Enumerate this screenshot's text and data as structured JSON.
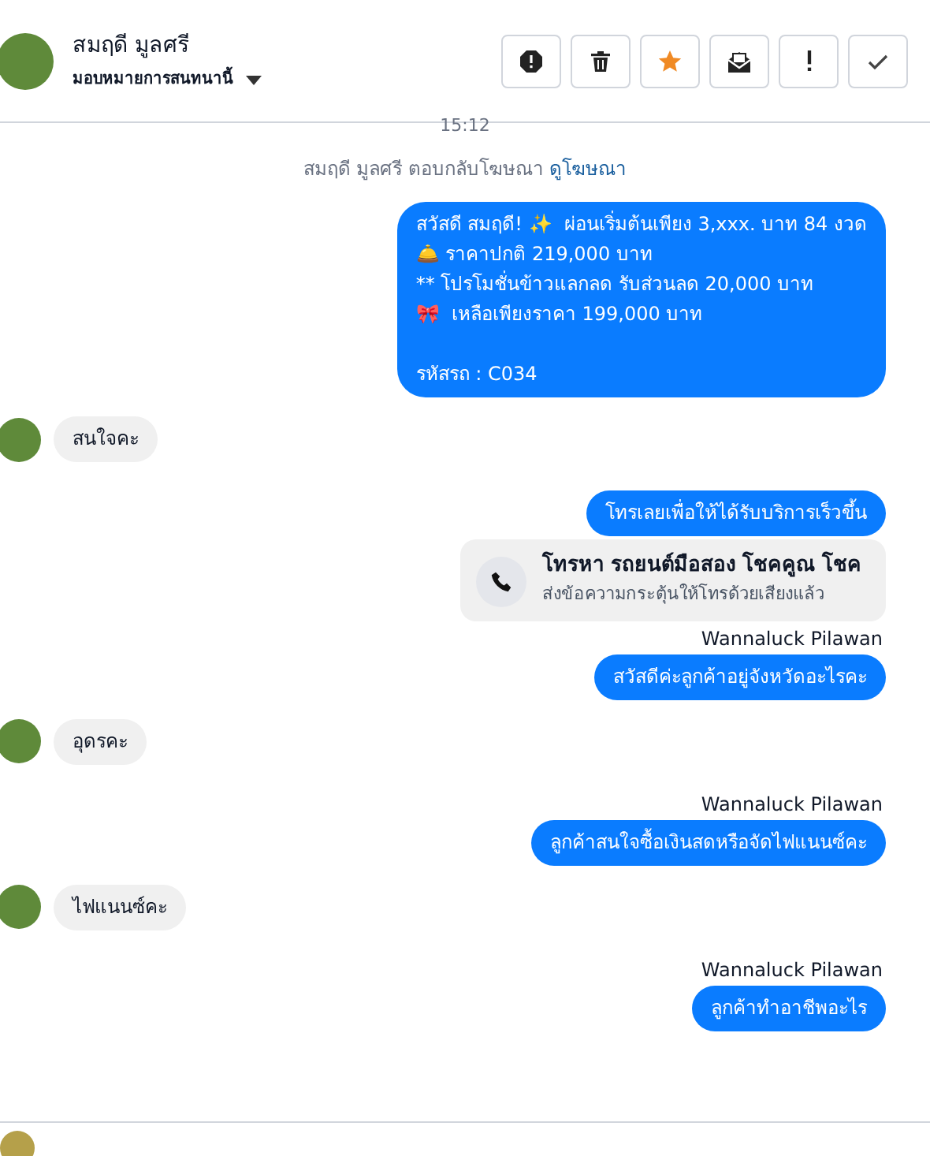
{
  "header": {
    "name": "สมฤดี มูลศรี",
    "assign": "มอบหมายการสนทนานี้",
    "actions": [
      {
        "kind": "spam"
      },
      {
        "kind": "trash"
      },
      {
        "kind": "star"
      },
      {
        "kind": "mail"
      },
      {
        "kind": "exclaim"
      },
      {
        "kind": "check"
      }
    ]
  },
  "time": "15:12",
  "notice": {
    "text": "สมฤดี มูลศรี ตอบกลับโฆษณา",
    "link": "ดูโฆษณา"
  },
  "messages": [
    {
      "kind": "out",
      "lines": [
        "สวัสดี สมฤดี! ✨  ผ่อนเริ่มต้นเพียง 3,xxx. บาท 84 งวด",
        "🛎️ ราคาปกติ 219,000 บาท",
        "** โปรโมชั่นข้าวแลกลด รับส่วนลด 20,000 บาท",
        "🎀  เหลือเพียงราคา 199,000 บาท"
      ],
      "code": "รหัสรถ : C034"
    },
    {
      "kind": "in",
      "lines": [
        "สนใจคะ"
      ]
    },
    {
      "kind": "out",
      "lines": [
        "โทรเลยเพื่อให้ได้รับบริการเร็วขึ้น"
      ]
    },
    {
      "kind": "call",
      "title": "โทรหา รถยนต์มือสอง โชคคูณ โชค",
      "subtitle": "ส่งข้อความกระตุ้นให้โทรด้วยเสียงแล้ว"
    },
    {
      "kind": "out",
      "sender": "Wannaluck Pilawan",
      "lines": [
        "สวัสดีค่ะลูกค้าอยู่จังหวัดอะไรคะ"
      ]
    },
    {
      "kind": "in",
      "lines": [
        "อุดรคะ"
      ]
    },
    {
      "kind": "out",
      "sender": "Wannaluck Pilawan",
      "lines": [
        "ลูกค้าสนใจซื้อเงินสดหรือจัดไฟแนนซ์คะ"
      ]
    },
    {
      "kind": "in",
      "lines": [
        "ไฟแนนซ์คะ"
      ]
    },
    {
      "kind": "out",
      "sender": "Wannaluck Pilawan",
      "lines": [
        "ลูกค้าทำอาชีพอะไร"
      ]
    }
  ]
}
